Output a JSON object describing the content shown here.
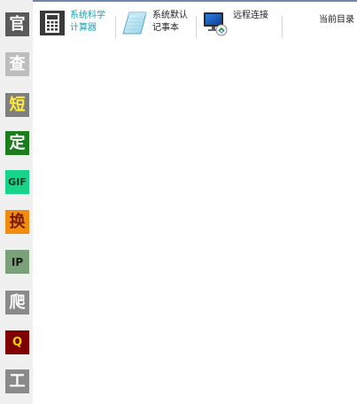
{
  "sidebar": {
    "items": [
      {
        "glyph": "官",
        "color": "#5a5a5a",
        "text_color": "#ffffff",
        "font_size": "18px"
      },
      {
        "glyph": "查",
        "color": "#bdbdbd",
        "text_color": "#ffffff",
        "font_size": "18px"
      },
      {
        "glyph": "短",
        "color": "#7f7f7f",
        "text_color": "#ffeb3b",
        "font_size": "18px"
      },
      {
        "glyph": "定",
        "color": "#1b7d1b",
        "text_color": "#ffffff",
        "font_size": "18px"
      },
      {
        "glyph": "GIF",
        "color": "#17d48a",
        "text_color": "#0a3a22",
        "font_size": "11px"
      },
      {
        "glyph": "换",
        "color": "#f08c10",
        "text_color": "#7a1b00",
        "font_size": "18px"
      },
      {
        "glyph": "IP",
        "color": "#7aa17a",
        "text_color": "#1b1b1b",
        "font_size": "12px"
      },
      {
        "glyph": "爬",
        "color": "#8a8a8a",
        "text_color": "#ffffff",
        "font_size": "18px"
      },
      {
        "glyph": "Q",
        "color": "#800000",
        "text_color": "#ffd400",
        "font_size": "13px"
      },
      {
        "glyph": "工",
        "color": "#8a8a8a",
        "text_color": "#ffffff",
        "font_size": "18px"
      }
    ]
  },
  "toolbar": {
    "calculator": {
      "line1": "系统科学",
      "line2": "计算器",
      "icon": "calculator-icon"
    },
    "notepad": {
      "line1": "系统默认",
      "line2": "记事本",
      "icon": "notepad-icon"
    },
    "remote": {
      "line1": "远程连接",
      "icon": "remote-desktop-icon"
    },
    "current_dir": "当前目录"
  }
}
